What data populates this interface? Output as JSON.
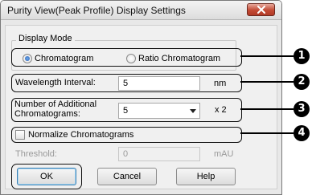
{
  "window": {
    "title": "Purity View(Peak Profile) Display Settings"
  },
  "display_mode": {
    "group_label": "Display Mode",
    "options": [
      "Chromatogram",
      "Ratio Chromatogram"
    ],
    "selected": "Chromatogram"
  },
  "wavelength_interval": {
    "label": "Wavelength Interval:",
    "value": "5",
    "unit": "nm"
  },
  "additional_chromatograms": {
    "label": "Number of Additional Chromatograms:",
    "value": "5",
    "suffix": "x 2"
  },
  "normalize": {
    "label": "Normalize Chromatograms",
    "checked": false
  },
  "threshold": {
    "label": "Threshold:",
    "value": "0",
    "unit": "mAU"
  },
  "buttons": {
    "ok": "OK",
    "cancel": "Cancel",
    "help": "Help"
  },
  "callouts": [
    "1",
    "2",
    "3",
    "4"
  ]
}
